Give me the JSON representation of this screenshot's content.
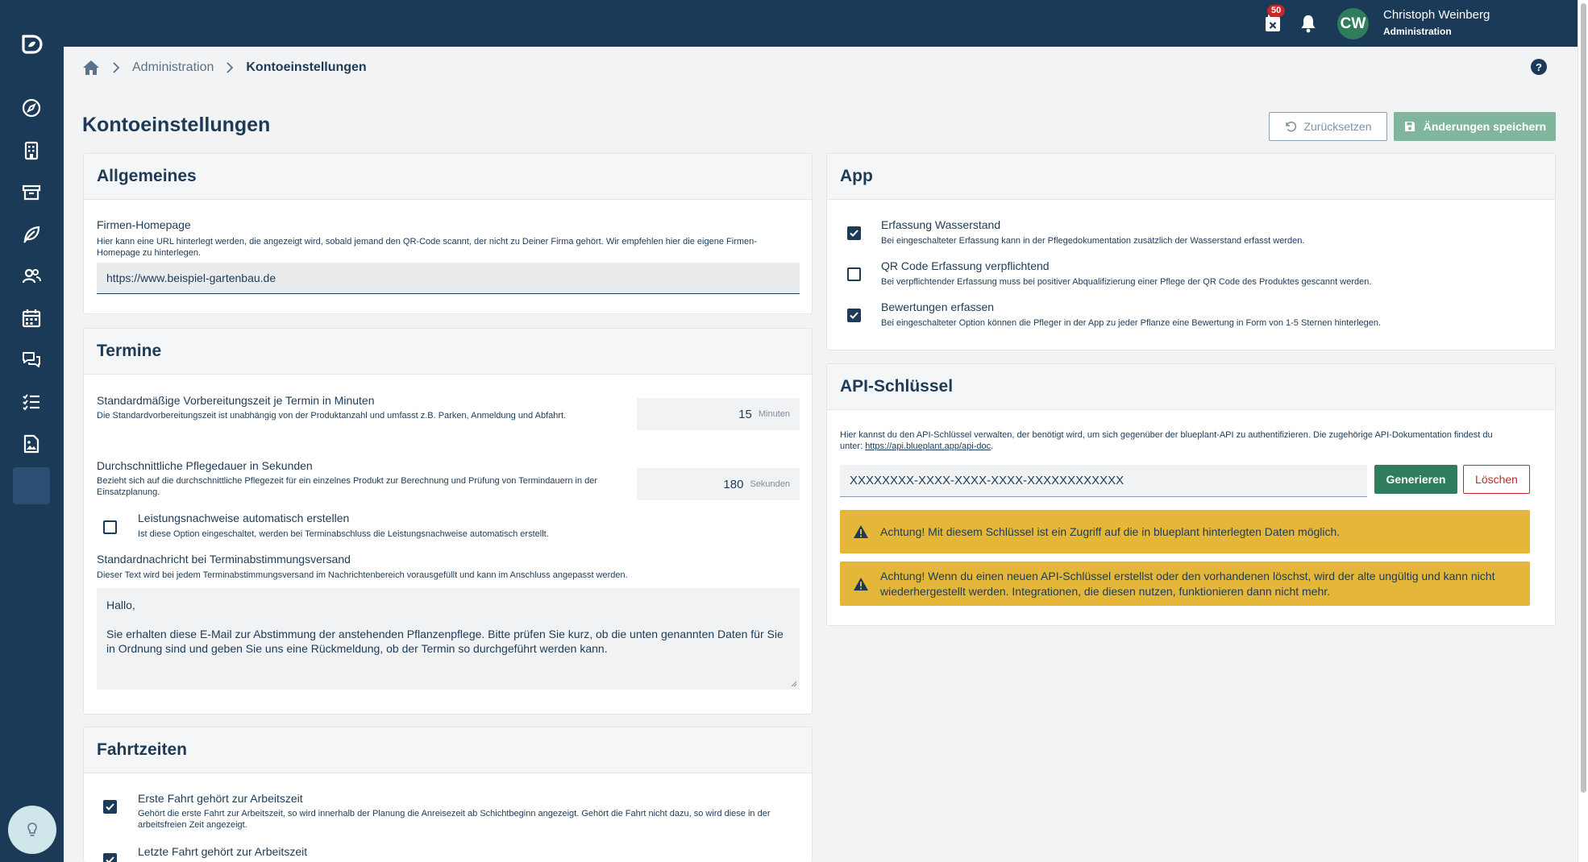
{
  "colors": {
    "primary": "#1b3a58",
    "accent_green": "#2f7d5c",
    "danger": "#c62828",
    "warning": "#e4b73b"
  },
  "sidebar": {
    "items": [
      {
        "icon": "compass-icon"
      },
      {
        "icon": "building-icon"
      },
      {
        "icon": "archive-icon"
      },
      {
        "icon": "leaf-icon"
      },
      {
        "icon": "users-icon"
      },
      {
        "icon": "calendar-icon"
      },
      {
        "icon": "chat-icon"
      },
      {
        "icon": "checklist-icon"
      },
      {
        "icon": "document-image-icon"
      }
    ]
  },
  "topbar": {
    "badge_count": "50",
    "user_initials": "CW",
    "user_name": "Christoph Weinberg",
    "user_role": "Administration"
  },
  "breadcrumb": {
    "item1": "Administration",
    "current": "Kontoeinstellungen"
  },
  "help_label": "?",
  "page": {
    "title": "Kontoeinstellungen",
    "reset_label": "Zurücksetzen",
    "save_label": "Änderungen speichern"
  },
  "allgemeines": {
    "title": "Allgemeines",
    "homepage_label": "Firmen-Homepage",
    "homepage_hint": "Hier kann eine URL hinterlegt werden, die angezeigt wird, sobald jemand den QR-Code scannt, der nicht zu Deiner Firma gehört. Wir empfehlen hier die eigene Firmen-Homepage zu hinterlegen.",
    "homepage_value": "https://www.beispiel-gartenbau.de"
  },
  "termine": {
    "title": "Termine",
    "prep_label": "Standardmäßige Vorbereitungszeit je Termin in Minuten",
    "prep_hint": "Die Standardvorbereitungszeit ist unabhängig von der Produktanzahl und umfasst z.B. Parken, Anmeldung und Abfahrt.",
    "prep_value": "15",
    "prep_unit": "Minuten",
    "care_label": "Durchschnittliche Pflegedauer in Sekunden",
    "care_hint": "Bezieht sich auf die durchschnittliche Pflegezeit für ein einzelnes Produkt zur Berechnung und Prüfung von Termindauern in der Einsatzplanung.",
    "care_value": "180",
    "care_unit": "Sekunden",
    "auto_label": "Leistungsnachweise automatisch erstellen",
    "auto_hint": "Ist diese Option eingeschaltet, werden bei Terminabschluss die Leistungsnachweise automatisch erstellt.",
    "auto_checked": false,
    "msg_label": "Standardnachricht bei Terminabstimmungsversand",
    "msg_hint": "Dieser Text wird bei jedem Terminabstimmungsversand im Nachrichtenbereich vorausgefüllt und kann im Anschluss angepasst werden.",
    "msg_line1": "Hallo,",
    "msg_line2": "Sie erhalten diese E-Mail zur Abstimmung der anstehenden Pflanzenpflege. Bitte prüfen Sie kurz, ob die unten genannten Daten für Sie in Ordnung sind und geben Sie uns eine Rückmeldung, ob der Termin so durchgeführt werden kann."
  },
  "fahrzeiten": {
    "title": "Fahrtzeiten",
    "first_label": "Erste Fahrt gehört zur Arbeitszeit",
    "first_hint": "Gehört die erste Fahrt zur Arbeitszeit, so wird innerhalb der Planung die Anreisezeit ab Schichtbeginn angezeigt. Gehört die Fahrt nicht dazu, so wird diese in der arbeitsfreien Zeit angezeigt.",
    "first_checked": true,
    "last_label": "Letzte Fahrt gehört zur Arbeitszeit",
    "last_checked": true
  },
  "app": {
    "title": "App",
    "options": [
      {
        "label": "Erfassung Wasserstand",
        "hint": "Bei eingeschalteter Erfassung kann in der Pflegedokumentation zusätzlich der Wasserstand erfasst werden.",
        "checked": true
      },
      {
        "label": "QR Code Erfassung verpflichtend",
        "hint": "Bei verpflichtender Erfassung muss bei positiver Abqualifizierung einer Pflege der QR Code des Produktes gescannt werden.",
        "checked": false
      },
      {
        "label": "Bewertungen erfassen",
        "hint": "Bei eingeschalteter Option können die Pfleger in der App zu jeder Pflanze eine Bewertung in Form von 1-5 Sternen hinterlegen.",
        "checked": true
      }
    ]
  },
  "api": {
    "title": "API-Schlüssel",
    "desc_prefix": "Hier kannst du den API-Schlüssel verwalten, der benötigt wird, um sich gegenüber der blueplant-API zu authentifizieren. Die zugehörige API-Dokumentation findest du unter: ",
    "desc_link": "https://api.blueplant.app/api-doc",
    "desc_suffix": ".",
    "key_value": "XXXXXXXX-XXXX-XXXX-XXXX-XXXXXXXXXXXX",
    "generate_label": "Generieren",
    "delete_label": "Löschen",
    "warning1": "Achtung! Mit diesem Schlüssel ist ein Zugriff auf die in blueplant hinterlegten Daten möglich.",
    "warning2": "Achtung! Wenn du einen neuen API-Schlüssel erstellst oder den vorhandenen löschst, wird der alte ungültig und kann nicht wiederhergestellt werden. Integrationen, die diesen nutzen, funktionieren dann nicht mehr."
  }
}
